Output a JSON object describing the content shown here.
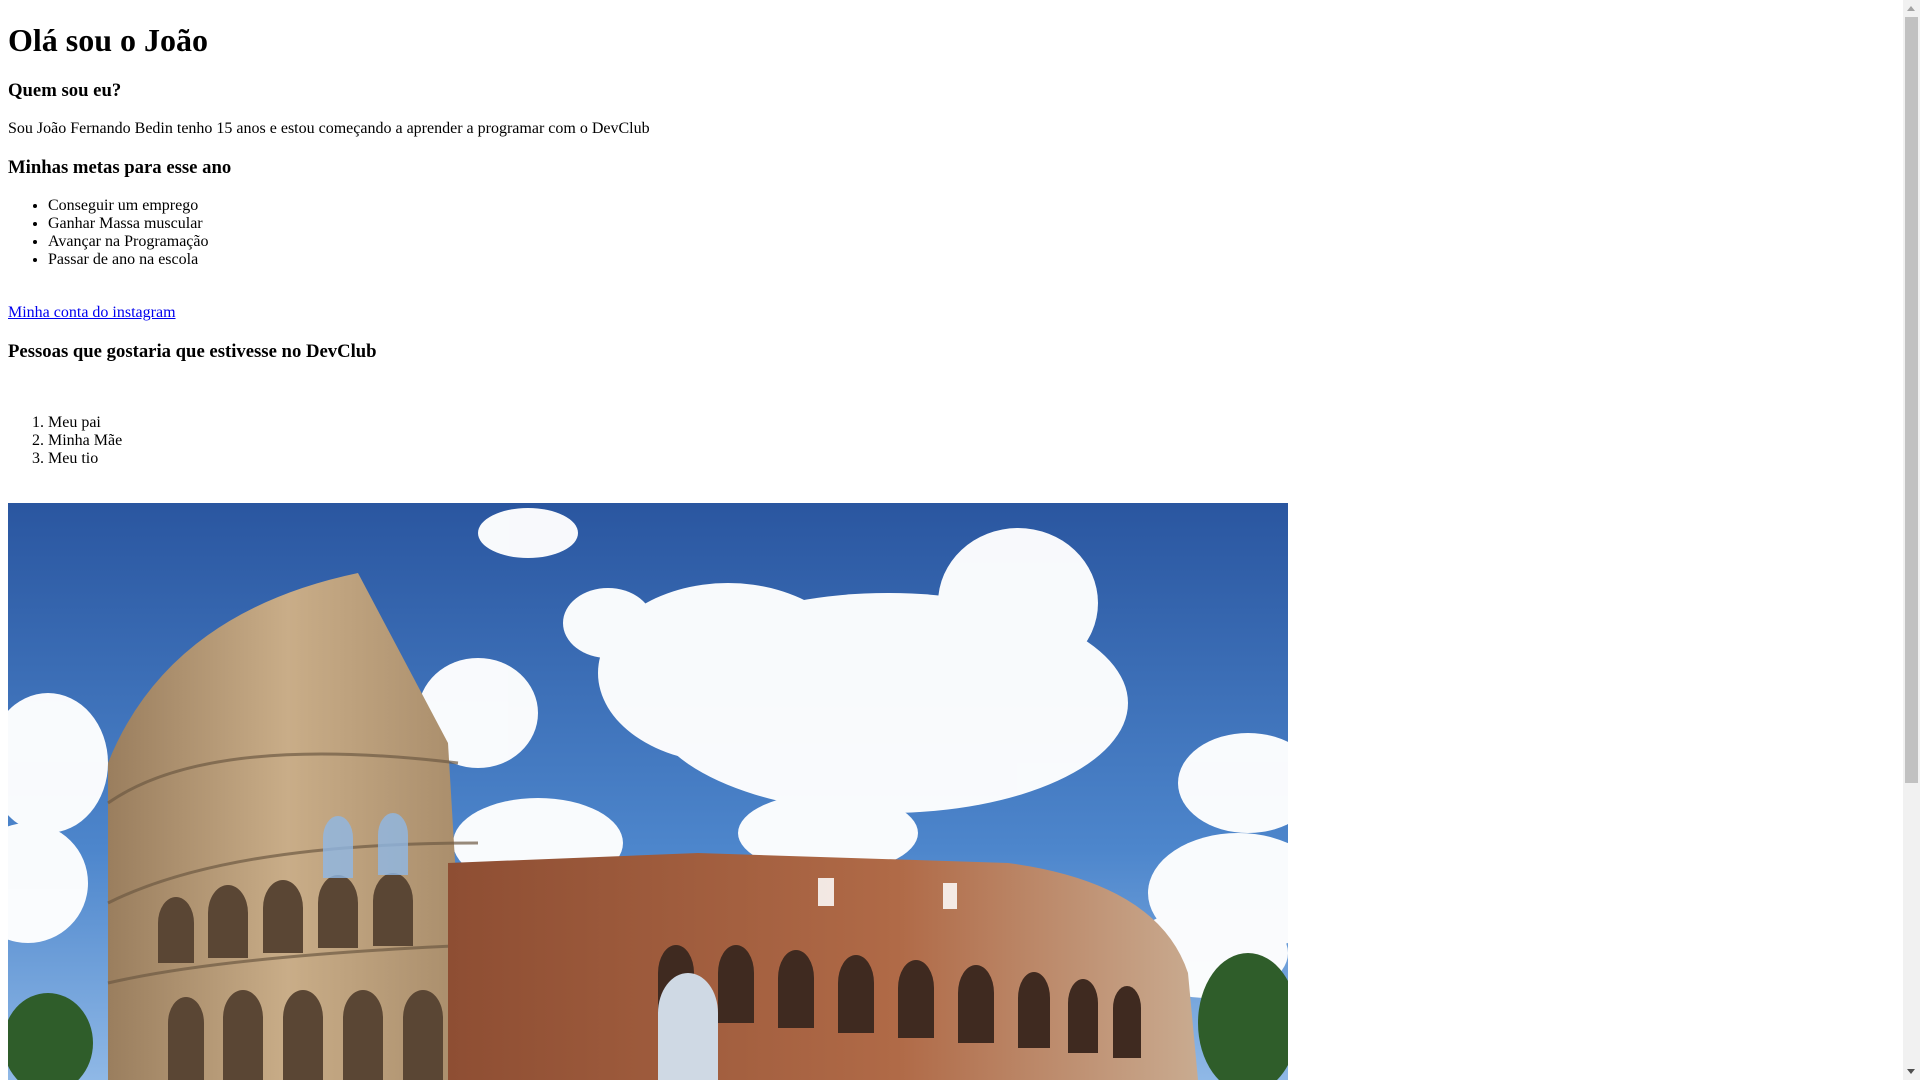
{
  "title": "Olá sou o João",
  "about": {
    "heading": "Quem sou eu?",
    "text": "Sou João Fernando Bedin tenho 15 anos e estou começando a aprender a programar com o DevClub"
  },
  "goals": {
    "heading": "Minhas metas para esse ano",
    "items": [
      "Conseguir um emprego",
      "Ganhar Massa muscular",
      "Avançar na Programação",
      "Passar de ano na escola"
    ]
  },
  "instagram_link": "Minha conta do instagram",
  "people": {
    "heading": "Pessoas que gostaria que estivesse no DevClub",
    "items": [
      "Meu pai",
      "Minha Mãe",
      "Meu tio"
    ]
  },
  "colors": {
    "link": "#0000ee",
    "sky": "#2f5fa8",
    "stone": "#b89a76",
    "brick": "#a0573a"
  }
}
